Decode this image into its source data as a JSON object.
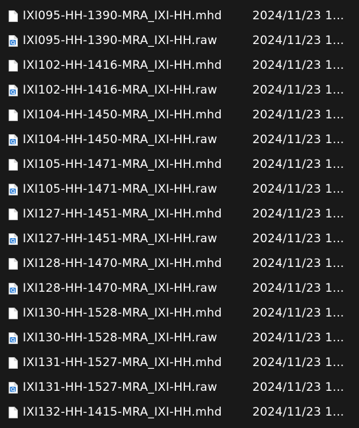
{
  "colors": {
    "background": "#191919",
    "text": "#ffffff",
    "raw_icon_accent": "#2f7fd6"
  },
  "files": [
    {
      "name": "IXI095-HH-1390-MRA_IXI-HH.mhd",
      "date": "2024/11/23 1...",
      "icon": "generic-file-icon"
    },
    {
      "name": "IXI095-HH-1390-MRA_IXI-HH.raw",
      "date": "2024/11/23 1...",
      "icon": "raw-file-icon"
    },
    {
      "name": "IXI102-HH-1416-MRA_IXI-HH.mhd",
      "date": "2024/11/23 1...",
      "icon": "generic-file-icon"
    },
    {
      "name": "IXI102-HH-1416-MRA_IXI-HH.raw",
      "date": "2024/11/23 1...",
      "icon": "raw-file-icon"
    },
    {
      "name": "IXI104-HH-1450-MRA_IXI-HH.mhd",
      "date": "2024/11/23 1...",
      "icon": "generic-file-icon"
    },
    {
      "name": "IXI104-HH-1450-MRA_IXI-HH.raw",
      "date": "2024/11/23 1...",
      "icon": "raw-file-icon"
    },
    {
      "name": "IXI105-HH-1471-MRA_IXI-HH.mhd",
      "date": "2024/11/23 1...",
      "icon": "generic-file-icon"
    },
    {
      "name": "IXI105-HH-1471-MRA_IXI-HH.raw",
      "date": "2024/11/23 1...",
      "icon": "raw-file-icon"
    },
    {
      "name": "IXI127-HH-1451-MRA_IXI-HH.mhd",
      "date": "2024/11/23 1...",
      "icon": "generic-file-icon"
    },
    {
      "name": "IXI127-HH-1451-MRA_IXI-HH.raw",
      "date": "2024/11/23 1...",
      "icon": "raw-file-icon"
    },
    {
      "name": "IXI128-HH-1470-MRA_IXI-HH.mhd",
      "date": "2024/11/23 1...",
      "icon": "generic-file-icon"
    },
    {
      "name": "IXI128-HH-1470-MRA_IXI-HH.raw",
      "date": "2024/11/23 1...",
      "icon": "raw-file-icon"
    },
    {
      "name": "IXI130-HH-1528-MRA_IXI-HH.mhd",
      "date": "2024/11/23 1...",
      "icon": "generic-file-icon"
    },
    {
      "name": "IXI130-HH-1528-MRA_IXI-HH.raw",
      "date": "2024/11/23 1...",
      "icon": "raw-file-icon"
    },
    {
      "name": "IXI131-HH-1527-MRA_IXI-HH.mhd",
      "date": "2024/11/23 1...",
      "icon": "generic-file-icon"
    },
    {
      "name": "IXI131-HH-1527-MRA_IXI-HH.raw",
      "date": "2024/11/23 1...",
      "icon": "raw-file-icon"
    },
    {
      "name": "IXI132-HH-1415-MRA_IXI-HH.mhd",
      "date": "2024/11/23 1...",
      "icon": "generic-file-icon"
    }
  ]
}
